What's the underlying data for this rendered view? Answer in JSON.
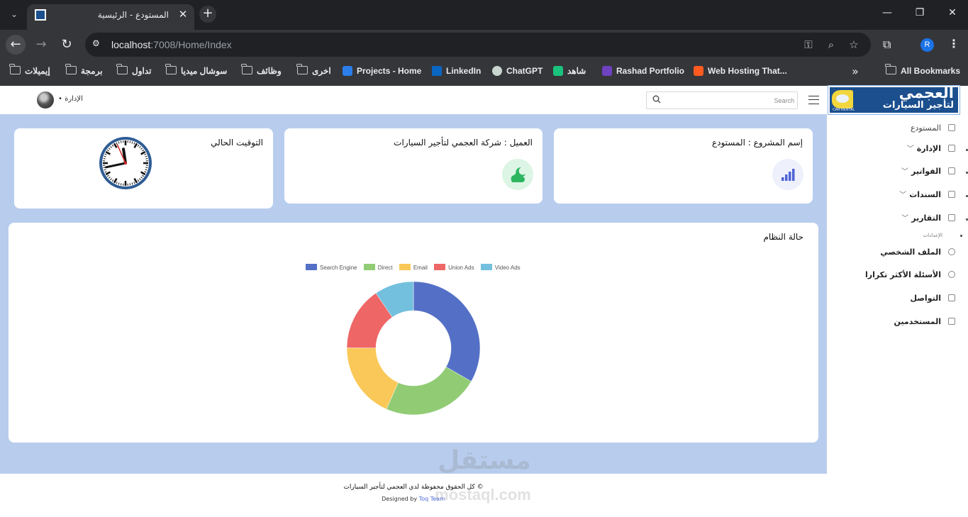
{
  "browser": {
    "tab_title": "المستودع - الرئيسية",
    "url_host": "localhost",
    "url_rest": ":7008/Home/Index",
    "profile_initial": "R",
    "bookmarks": [
      {
        "label": "إيميلات",
        "type": "folder"
      },
      {
        "label": "برمجة",
        "type": "folder"
      },
      {
        "label": "تداول",
        "type": "folder"
      },
      {
        "label": "سوشال ميديا",
        "type": "folder"
      },
      {
        "label": "وظائف",
        "type": "folder"
      },
      {
        "label": "اخرى",
        "type": "folder"
      },
      {
        "label": "Projects - Home",
        "type": "link"
      },
      {
        "label": "LinkedIn",
        "type": "link"
      },
      {
        "label": "ChatGPT",
        "type": "link"
      },
      {
        "label": "شاهد",
        "type": "link"
      },
      {
        "label": "Rashad Portfolio",
        "type": "link"
      },
      {
        "label": "Web Hosting That...",
        "type": "link"
      }
    ],
    "all_bookmarks": "All Bookmarks"
  },
  "header": {
    "user_label": "الإدارة",
    "search_placeholder": "Search"
  },
  "cards": {
    "project": "إسم المشروع : المستودع",
    "client": "العميل : شركة العجمي لتأجير السيارات",
    "time": "التوقيت الحالي"
  },
  "clock": {
    "hour": 11,
    "minute": 43,
    "second": 56
  },
  "status_title": "حالة النظام",
  "chart_data": {
    "type": "pie",
    "style": "doughnut",
    "categories": [
      "Search Engine",
      "Direct",
      "Email",
      "Union Ads",
      "Video Ads"
    ],
    "values": [
      1048,
      735,
      580,
      484,
      300
    ],
    "colors": [
      "#5470c6",
      "#91cc75",
      "#fac858",
      "#ee6666",
      "#73c0de"
    ],
    "legend_position": "top"
  },
  "footer": {
    "copyright": "© كل الحقوق محفوظة لدي العجمي لتأجير السيارات",
    "designed_by": "Designed by",
    "team": "Toq Team",
    "watermark": "مستقل",
    "watermark_url": "mostaql.com"
  },
  "sidebar": {
    "logo_top": "العجمي",
    "logo_bottom": "لتأجير السيارات",
    "logo_small": "CAR RENTAL",
    "items": [
      {
        "label": "المستودع",
        "caret": false
      },
      {
        "label": "الإدارة",
        "caret": true
      },
      {
        "label": "الفواتير",
        "caret": true
      },
      {
        "label": "السندات",
        "caret": true
      },
      {
        "label": "التقارير",
        "caret": true
      }
    ],
    "section": "الإعدادات",
    "settings": [
      {
        "label": "الملف الشخصي"
      },
      {
        "label": "الأسئلة الأكثر تكرارا"
      },
      {
        "label": "التواصل"
      },
      {
        "label": "المستخدمين"
      }
    ]
  }
}
